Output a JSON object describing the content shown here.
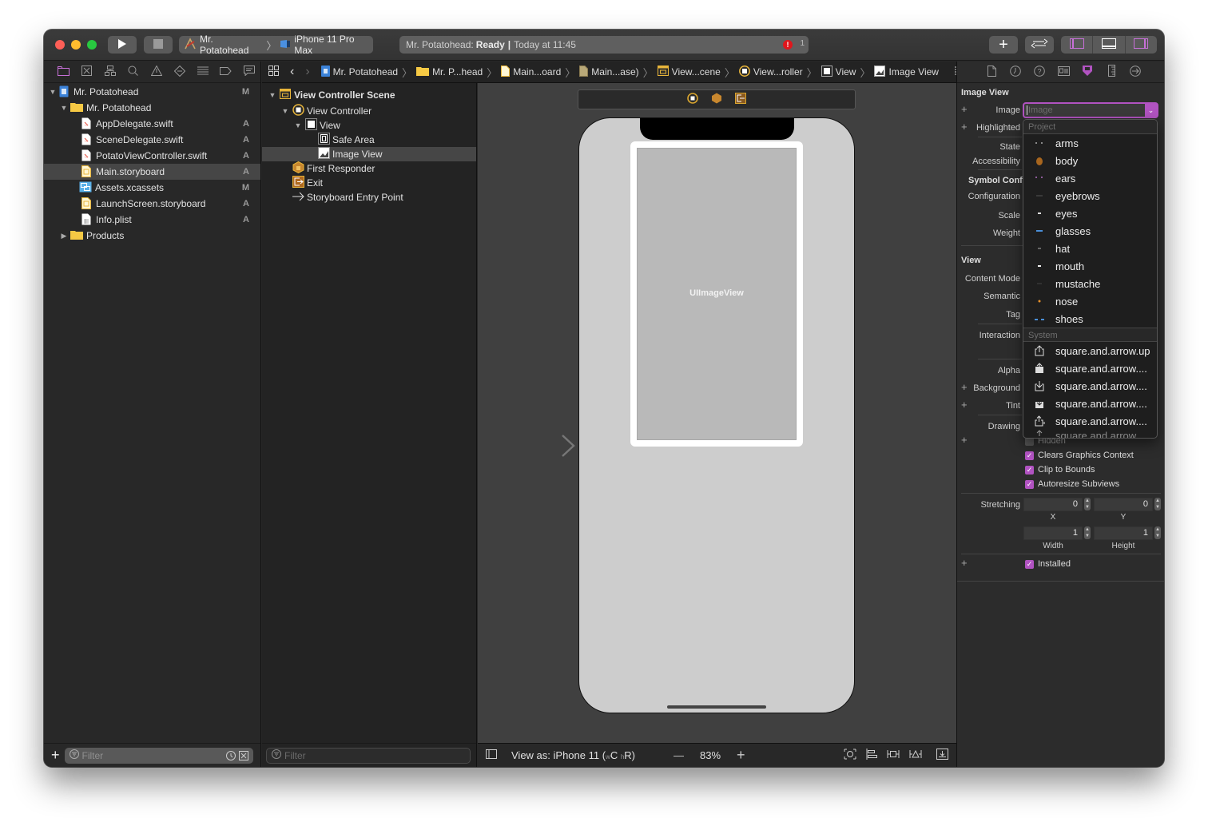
{
  "toolbar": {
    "scheme_project": "Mr. Potatohead",
    "scheme_device": "iPhone 11 Pro Max",
    "activity_project": "Mr. Potatohead:",
    "activity_status": "Ready",
    "activity_time": "Today at 11:45",
    "error_count": "1",
    "error_glyph": "!",
    "run_icon": "▶",
    "add_icon": "+"
  },
  "navigator": {
    "tabs": [
      "project-navigator",
      "source-control-navigator",
      "symbol-navigator",
      "find-navigator",
      "issue-navigator",
      "test-navigator",
      "debug-navigator",
      "breakpoint-navigator",
      "report-navigator"
    ],
    "tree": [
      {
        "label": "Mr. Potatohead",
        "status": "M",
        "type": "project",
        "level": 0,
        "disclosure": "▼"
      },
      {
        "label": "Mr. Potatohead",
        "status": "",
        "type": "folder",
        "level": 1,
        "disclosure": "▼"
      },
      {
        "label": "AppDelegate.swift",
        "status": "A",
        "type": "swift",
        "level": 2
      },
      {
        "label": "SceneDelegate.swift",
        "status": "A",
        "type": "swift",
        "level": 2
      },
      {
        "label": "PotatoViewController.swift",
        "status": "A",
        "type": "swift",
        "level": 2
      },
      {
        "label": "Main.storyboard",
        "status": "A",
        "type": "storyboard",
        "level": 2,
        "selected": true
      },
      {
        "label": "Assets.xcassets",
        "status": "M",
        "type": "assets",
        "level": 2
      },
      {
        "label": "LaunchScreen.storyboard",
        "status": "A",
        "type": "storyboard",
        "level": 2
      },
      {
        "label": "Info.plist",
        "status": "A",
        "type": "plist",
        "level": 2
      },
      {
        "label": "Products",
        "status": "",
        "type": "folder",
        "level": 1,
        "disclosure": "▶"
      }
    ],
    "filter_placeholder": "Filter",
    "add_icon": "+"
  },
  "jumpbar": {
    "items": [
      "Mr. Potatohead",
      "Mr. P...head",
      "Main...oard",
      "Main...ase)",
      "View...cene",
      "View...roller",
      "View",
      "Image View"
    ],
    "separator": "〉"
  },
  "outline": {
    "rows": [
      {
        "label": "View Controller Scene",
        "level": 0,
        "disclosure": "▼",
        "bold": true,
        "icon": "scene"
      },
      {
        "label": "View Controller",
        "level": 1,
        "disclosure": "▼",
        "icon": "view-controller"
      },
      {
        "label": "View",
        "level": 2,
        "disclosure": "▼",
        "icon": "view"
      },
      {
        "label": "Safe Area",
        "level": 3,
        "icon": "safe-area"
      },
      {
        "label": "Image View",
        "level": 3,
        "icon": "image-view",
        "selected": true
      },
      {
        "label": "First Responder",
        "level": 1,
        "icon": "first-responder"
      },
      {
        "label": "Exit",
        "level": 1,
        "icon": "exit"
      },
      {
        "label": "Storyboard Entry Point",
        "level": 1,
        "icon": "entry-arrow"
      }
    ],
    "filter_placeholder": "Filter"
  },
  "canvas": {
    "image_view_label": "UIImageView",
    "view_as": "View as: iPhone 11 (",
    "size_class_w": "w",
    "size_class_w_val": "C",
    "size_class_h": "h",
    "size_class_h_val": "R)",
    "zoom": "83%",
    "zoom_out": "—",
    "zoom_in": "+"
  },
  "inspector": {
    "section_image_view": "Image View",
    "labels": {
      "image": "Image",
      "highlighted": "Highlighted",
      "state": "State",
      "accessibility": "Accessibility",
      "symbol_config": "Symbol Config",
      "configuration": "Configuration",
      "scale": "Scale",
      "weight": "Weight",
      "content_mode": "Content Mode",
      "semantic": "Semantic",
      "tag": "Tag",
      "interaction": "Interaction",
      "alpha": "Alpha",
      "background": "Background",
      "tint": "Tint",
      "drawing": "Drawing",
      "stretching": "Stretching"
    },
    "section_view": "View",
    "image_placeholder": "Image",
    "checkboxes": [
      {
        "label": "Hidden",
        "checked": false
      },
      {
        "label": "Clears Graphics Context",
        "checked": true
      },
      {
        "label": "Clip to Bounds",
        "checked": true
      },
      {
        "label": "Autoresize Subviews",
        "checked": true
      }
    ],
    "stretching": {
      "x": "0",
      "y": "0",
      "width": "1",
      "height": "1",
      "x_label": "X",
      "y_label": "Y",
      "width_label": "Width",
      "height_label": "Height"
    },
    "installed": {
      "label": "Installed",
      "checked": true
    },
    "plus": "+"
  },
  "image_dropdown": {
    "project_header": "Project",
    "project_items": [
      "arms",
      "body",
      "ears",
      "eyebrows",
      "eyes",
      "glasses",
      "hat",
      "mouth",
      "mustache",
      "nose",
      "shoes"
    ],
    "system_header": "System",
    "system_items": [
      "square.and.arrow.up",
      "square.and.arrow....",
      "square.and.arrow....",
      "square.and.arrow....",
      "square.and.arrow....",
      "square.and.arrow..."
    ]
  },
  "colors": {
    "accent": "#b153c1",
    "error": "#e0161c",
    "storyboard_yellow": "#e8b53a",
    "folder_yellow": "#f6c944",
    "canvas_bg": "#404040"
  }
}
